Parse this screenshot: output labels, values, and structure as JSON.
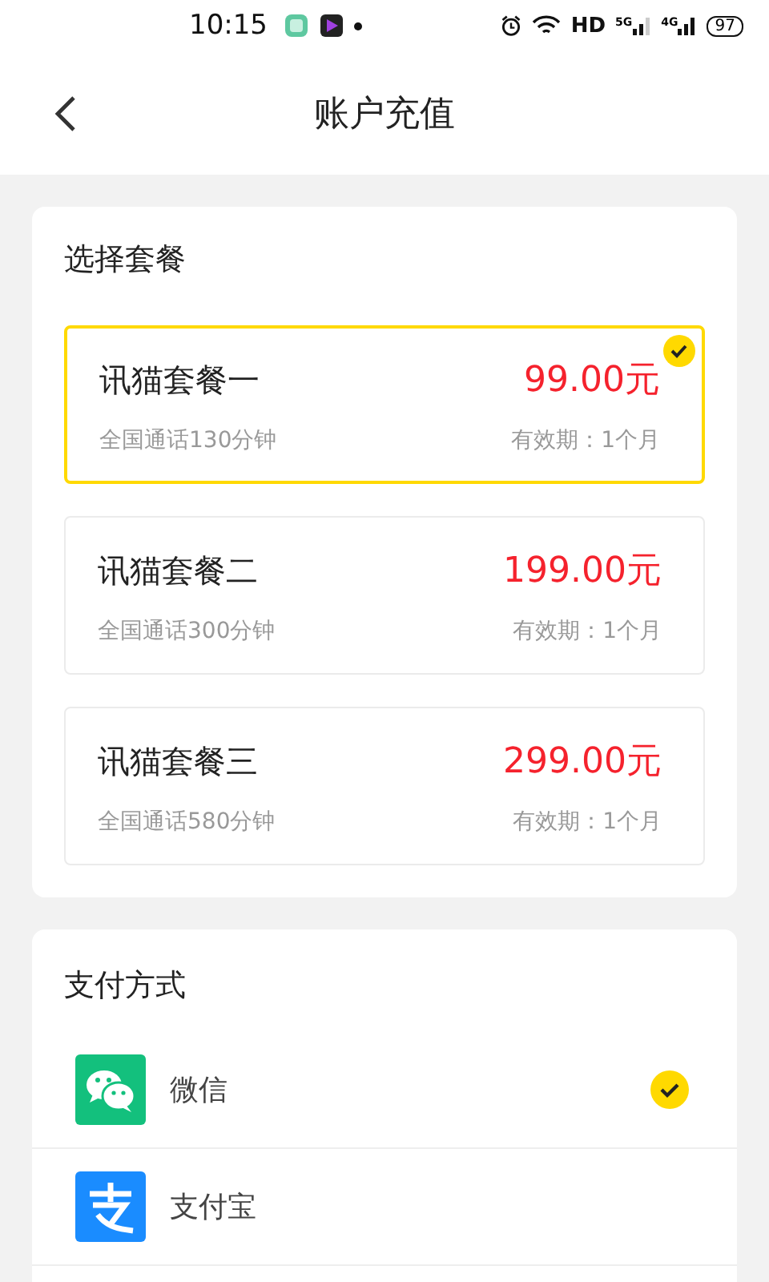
{
  "status_bar": {
    "time": "10:15",
    "network_label": "HD",
    "signal_1_label": "5G",
    "signal_2_label": "4G",
    "battery": "97"
  },
  "header": {
    "title": "账户充值"
  },
  "plans": {
    "title": "选择套餐",
    "items": [
      {
        "name": "讯猫套餐一",
        "price": "99.00元",
        "minutes": "全国通话130分钟",
        "validity": "有效期：1个月",
        "selected": true
      },
      {
        "name": "讯猫套餐二",
        "price": "199.00元",
        "minutes": "全国通话300分钟",
        "validity": "有效期：1个月",
        "selected": false
      },
      {
        "name": "讯猫套餐三",
        "price": "299.00元",
        "minutes": "全国通话580分钟",
        "validity": "有效期：1个月",
        "selected": false
      }
    ]
  },
  "payment": {
    "title": "支付方式",
    "methods": [
      {
        "kind": "wechat",
        "label": "微信",
        "selected": true
      },
      {
        "kind": "alipay",
        "label": "支付宝",
        "selected": false
      }
    ]
  }
}
